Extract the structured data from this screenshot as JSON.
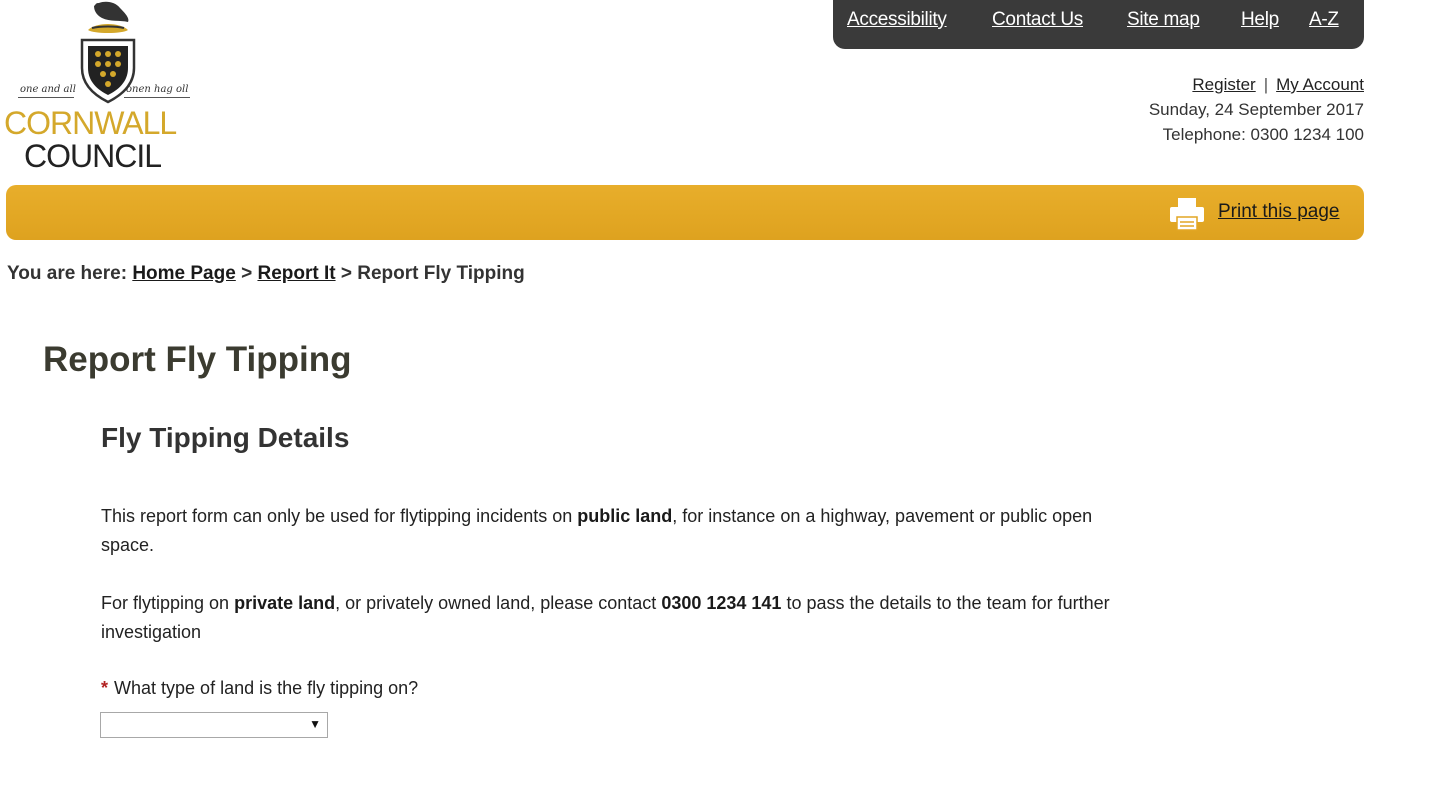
{
  "logo": {
    "motto_left": "one and all",
    "motto_right": "onen hag oll",
    "word1": "CORNWALL",
    "word2": "COUNCIL"
  },
  "topnav": [
    "Accessibility",
    "Contact Us",
    "Site map",
    "Help",
    "A-Z"
  ],
  "account": {
    "register": "Register",
    "separator": "|",
    "my_account": "My Account",
    "date": "Sunday, 24 September 2017",
    "telephone": "Telephone: 0300 1234 100"
  },
  "toolbar": {
    "print_label": "Print this page",
    "print_icon": "printer-icon"
  },
  "breadcrumb": {
    "prefix": "You are here:",
    "home": "Home Page",
    "sep": ">",
    "report_it": "Report It",
    "current": "Report Fly Tipping"
  },
  "page": {
    "title": "Report Fly Tipping",
    "section_title": "Fly Tipping Details",
    "para1": {
      "a": "This report form can only be used for flytipping incidents on ",
      "b": "public land",
      "c": ", for instance on a highway, pavement or public open space."
    },
    "para2": {
      "a": "For flytipping on ",
      "b": "private land",
      "c": ", or privately owned land, please contact ",
      "d": "0300 1234 141",
      "e": " to pass the details to the team for further investigation"
    }
  },
  "form": {
    "required_marker": "*",
    "question": "What type of land is the fly tipping on?",
    "select_value": "",
    "select_arrow": "▼"
  },
  "colors": {
    "brand_yellow": "#e2a624",
    "nav_dark": "#3a3a3a",
    "required_red": "#b22222"
  }
}
